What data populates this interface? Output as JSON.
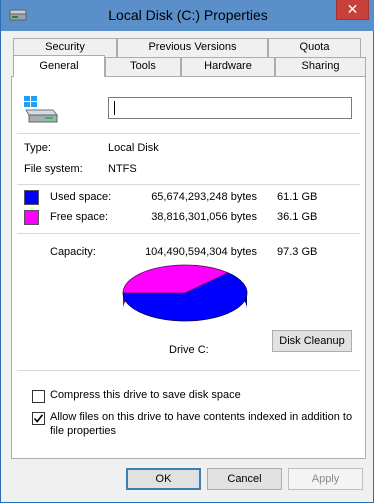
{
  "window": {
    "title": "Local Disk (C:) Properties",
    "close_label": "✕"
  },
  "tabs": {
    "row_back": [
      "Security",
      "Previous Versions",
      "Quota"
    ],
    "row_front": [
      "General",
      "Tools",
      "Hardware",
      "Sharing"
    ],
    "active": "General"
  },
  "general": {
    "name_value": "",
    "type_label": "Type:",
    "type_value": "Local Disk",
    "fs_label": "File system:",
    "fs_value": "NTFS",
    "used": {
      "label": "Used space:",
      "bytes": "65,674,293,248 bytes",
      "size": "61.1 GB",
      "color": "#0000ff"
    },
    "free": {
      "label": "Free space:",
      "bytes": "38,816,301,056 bytes",
      "size": "36.1 GB",
      "color": "#ff00ff"
    },
    "capacity": {
      "label": "Capacity:",
      "bytes": "104,490,594,304 bytes",
      "size": "97.3 GB"
    },
    "used_fraction": 0.6285,
    "drive_label": "Drive C:",
    "cleanup_label": "Disk Cleanup",
    "compress_label": "Compress this drive to save disk space",
    "compress_checked": false,
    "index_label_line1": "Allow files on this drive to have contents indexed in addition to",
    "index_label_line2": "file properties",
    "index_checked": true
  },
  "buttons": {
    "ok": "OK",
    "cancel": "Cancel",
    "apply": "Apply"
  }
}
